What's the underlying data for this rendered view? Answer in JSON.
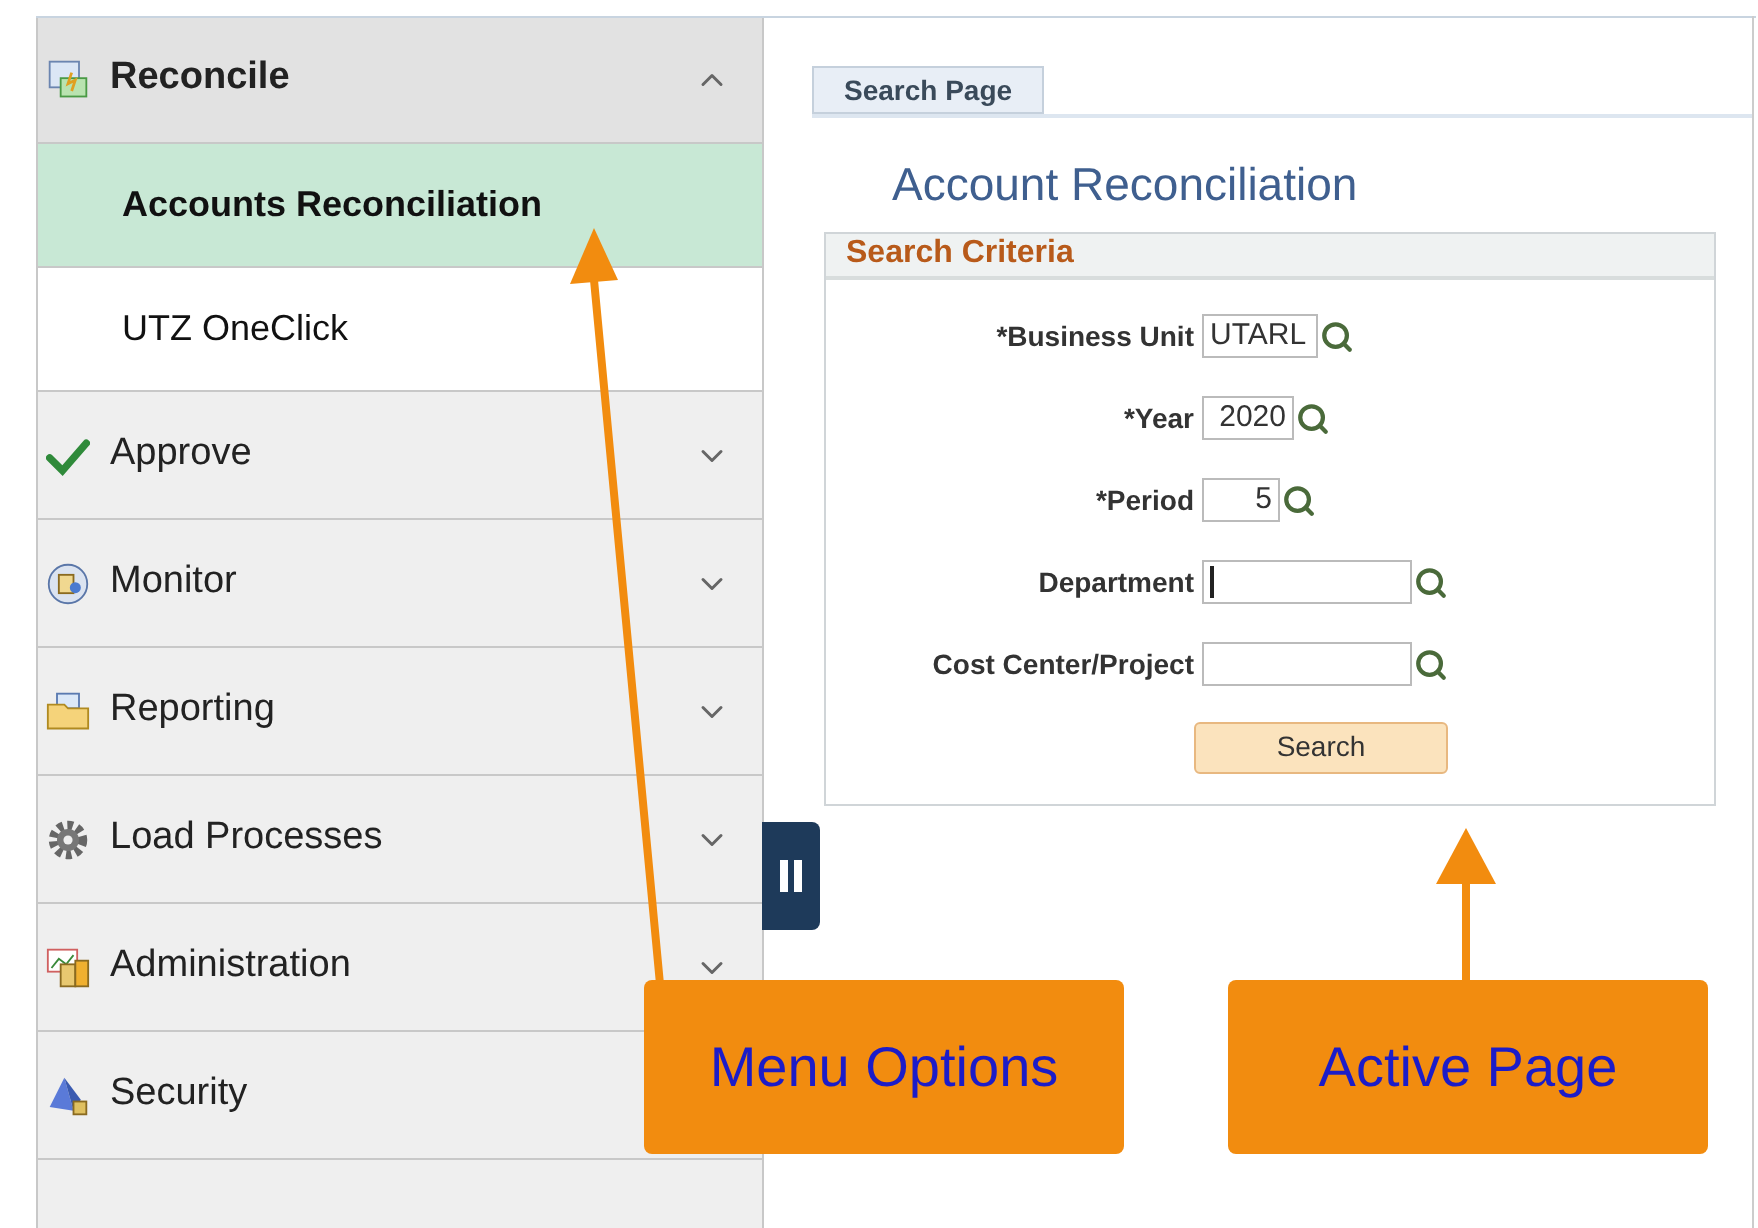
{
  "sidebar": {
    "items": [
      {
        "kind": "group",
        "label": "Reconcile",
        "expanded": true,
        "children": [
          {
            "label": "Accounts Reconciliation",
            "selected": true
          },
          {
            "label": "UTZ OneClick",
            "selected": false
          }
        ]
      },
      {
        "kind": "group",
        "label": "Approve",
        "expanded": false
      },
      {
        "kind": "group",
        "label": "Monitor",
        "expanded": false
      },
      {
        "kind": "group",
        "label": "Reporting",
        "expanded": false
      },
      {
        "kind": "group",
        "label": "Load Processes",
        "expanded": false
      },
      {
        "kind": "group",
        "label": "Administration",
        "expanded": false
      },
      {
        "kind": "group",
        "label": "Security",
        "expanded": false
      }
    ]
  },
  "tabs": [
    {
      "label": "Search Page",
      "selected": true
    }
  ],
  "page_title": "Account Reconciliation",
  "search_criteria": {
    "title": "Search Criteria",
    "fields": [
      {
        "label": "*Business Unit",
        "value": "UTARL",
        "focused": false
      },
      {
        "label": "*Year",
        "value": "2020",
        "focused": false
      },
      {
        "label": "*Period",
        "value": "5",
        "focused": false
      },
      {
        "label": "Department",
        "focused": true
      },
      {
        "label": "Cost Center/Project",
        "focused": false
      }
    ],
    "button": "Search"
  },
  "annotations": [
    {
      "text": "Menu Options"
    },
    {
      "text": "Active Page"
    }
  ]
}
